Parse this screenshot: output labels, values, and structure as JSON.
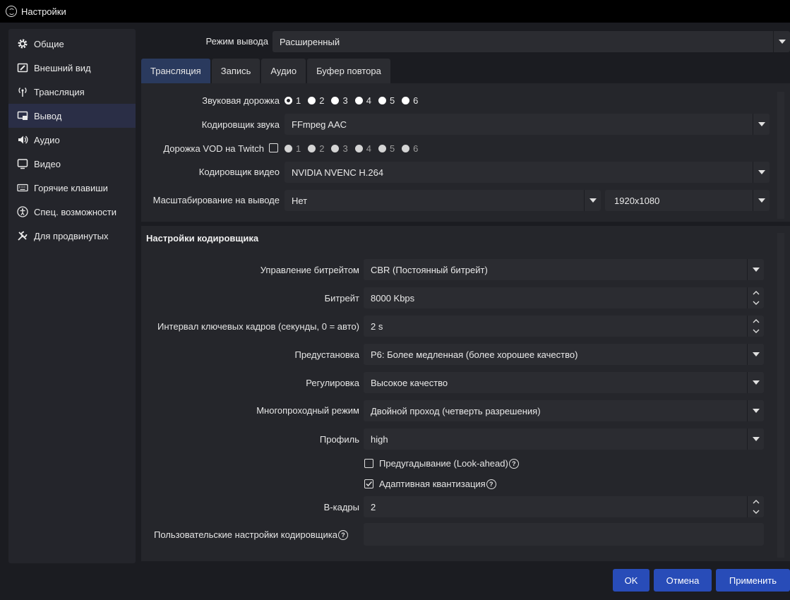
{
  "window": {
    "title": "Настройки"
  },
  "sidebar": {
    "items": [
      {
        "label": "Общие",
        "icon": "gear-icon"
      },
      {
        "label": "Внешний вид",
        "icon": "appearance-icon"
      },
      {
        "label": "Трансляция",
        "icon": "antenna-icon"
      },
      {
        "label": "Вывод",
        "icon": "output-icon",
        "active": true
      },
      {
        "label": "Аудио",
        "icon": "speaker-icon"
      },
      {
        "label": "Видео",
        "icon": "monitor-icon"
      },
      {
        "label": "Горячие клавиши",
        "icon": "keyboard-icon"
      },
      {
        "label": "Спец. возможности",
        "icon": "accessibility-icon"
      },
      {
        "label": "Для продвинутых",
        "icon": "wrench-icon"
      }
    ]
  },
  "output_mode": {
    "label": "Режим вывода",
    "value": "Расширенный"
  },
  "tabs": [
    "Трансляция",
    "Запись",
    "Аудио",
    "Буфер повтора"
  ],
  "stream": {
    "audio_track": {
      "label": "Звуковая дорожка",
      "options": [
        "1",
        "2",
        "3",
        "4",
        "5",
        "6"
      ],
      "selected": "1"
    },
    "audio_encoder": {
      "label": "Кодировщик звука",
      "value": "FFmpeg AAC"
    },
    "vod_track": {
      "label": "Дорожка VOD на Twitch",
      "options": [
        "1",
        "2",
        "3",
        "4",
        "5",
        "6"
      ],
      "selected": "2"
    },
    "video_encoder": {
      "label": "Кодировщик видео",
      "value": "NVIDIA NVENC H.264"
    },
    "rescale": {
      "label": "Масштабирование на выводе",
      "value": "Нет",
      "resolution": "1920x1080"
    }
  },
  "encoder": {
    "section_title": "Настройки кодировщика",
    "rate_control": {
      "label": "Управление битрейтом",
      "value": "CBR (Постоянный битрейт)"
    },
    "bitrate": {
      "label": "Битрейт",
      "value": "8000 Kbps"
    },
    "keyframe": {
      "label": "Интервал ключевых кадров (секунды, 0 = авто)",
      "value": "2 s"
    },
    "preset": {
      "label": "Предустановка",
      "value": "P6: Более медленная (более хорошее качество)"
    },
    "tuning": {
      "label": "Регулировка",
      "value": "Высокое качество"
    },
    "multipass": {
      "label": "Многопроходный режим",
      "value": "Двойной проход (четверть разрешения)"
    },
    "profile": {
      "label": "Профиль",
      "value": "high"
    },
    "lookahead": {
      "label": "Предугадывание (Look-ahead)",
      "checked": false
    },
    "adaptive_quant": {
      "label": "Адаптивная квантизация",
      "checked": true
    },
    "bframes": {
      "label": "B-кадры",
      "value": "2"
    },
    "custom": {
      "label": "Пользовательские настройки кодировщика",
      "value": ""
    }
  },
  "buttons": {
    "ok": "OK",
    "cancel": "Отмена",
    "apply": "Применить"
  },
  "colors": {
    "accent": "#284cb8",
    "active_tab": "#2a3a5e",
    "sidebar_active": "#2a2e46",
    "background": "#1b1c21"
  }
}
